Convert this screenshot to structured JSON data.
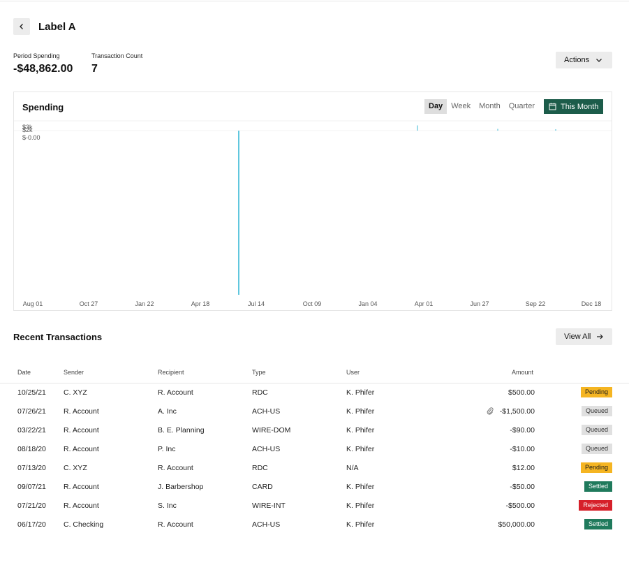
{
  "header": {
    "title": "Label A",
    "back_icon": "chevron-left-icon"
  },
  "stats": {
    "period_spending_label": "Period Spending",
    "period_spending_value": "-$48,862.00",
    "transaction_count_label": "Transaction Count",
    "transaction_count_value": "7"
  },
  "actions": {
    "label": "Actions",
    "icon": "chevron-down-icon"
  },
  "chart": {
    "title": "Spending",
    "periods": [
      "Day",
      "Week",
      "Month",
      "Quarter"
    ],
    "active_period": "Day",
    "range_label": "This Month",
    "range_icon": "calendar-icon",
    "colors": {
      "accent": "#1c5c4a",
      "line": "#39b9d6"
    }
  },
  "chart_data": {
    "type": "line",
    "title": "Spending",
    "xlabel": "",
    "ylabel": "",
    "x_tick_labels": [
      "Aug 01",
      "Oct 27",
      "Jan 22",
      "Apr 18",
      "Jul 14",
      "Oct 09",
      "Jan 04",
      "Apr 01",
      "Jun 27",
      "Sep 22",
      "Dec 18"
    ],
    "y_tick_labels": [
      "$3k",
      "$2k",
      "$-0.00"
    ],
    "x_range": [
      "Aug 01",
      "Dec 18"
    ],
    "grid": false,
    "series": [
      {
        "spikes": [
          {
            "x": "Jun 17",
            "y": 50000
          },
          {
            "x": "Jul 26",
            "y": -1500
          },
          {
            "x": "Mar 22",
            "y": -90
          },
          {
            "x": "Jul 13",
            "y": 12
          },
          {
            "x": "Oct 25",
            "y": 500
          }
        ]
      }
    ]
  },
  "recent": {
    "title": "Recent Transactions",
    "view_all_label": "View All",
    "view_all_icon": "arrow-right-icon"
  },
  "table": {
    "columns": {
      "date": "Date",
      "sender": "Sender",
      "recipient": "Recipient",
      "type": "Type",
      "user": "User",
      "amount": "Amount"
    },
    "rows": [
      {
        "date": "10/25/21",
        "sender": "C. XYZ",
        "recipient": "R. Account",
        "type": "RDC",
        "user": "K. Phifer",
        "amount": "$500.00",
        "attachment": false,
        "status": "Pending",
        "status_color": "#f5b522"
      },
      {
        "date": "07/26/21",
        "sender": "R. Account",
        "recipient": "A. Inc",
        "type": "ACH-US",
        "user": "K. Phifer",
        "amount": "-$1,500.00",
        "attachment": true,
        "status": "Queued",
        "status_color": "#e0e0e0"
      },
      {
        "date": "03/22/21",
        "sender": "R. Account",
        "recipient": "B. E. Planning",
        "type": "WIRE-DOM",
        "user": "K. Phifer",
        "amount": "-$90.00",
        "attachment": false,
        "status": "Queued",
        "status_color": "#e0e0e0"
      },
      {
        "date": "08/18/20",
        "sender": "R. Account",
        "recipient": "P. Inc",
        "type": "ACH-US",
        "user": "K. Phifer",
        "amount": "-$10.00",
        "attachment": false,
        "status": "Queued",
        "status_color": "#e0e0e0"
      },
      {
        "date": "07/13/20",
        "sender": "C. XYZ",
        "recipient": "R. Account",
        "type": "RDC",
        "user": "N/A",
        "amount": "$12.00",
        "attachment": false,
        "status": "Pending",
        "status_color": "#f5b522"
      },
      {
        "date": "09/07/21",
        "sender": "R. Account",
        "recipient": "J. Barbershop",
        "type": "CARD",
        "user": "K. Phifer",
        "amount": "-$50.00",
        "attachment": false,
        "status": "Settled",
        "status_color": "#1f7a5c"
      },
      {
        "date": "07/21/20",
        "sender": "R. Account",
        "recipient": "S. Inc",
        "type": "WIRE-INT",
        "user": "K. Phifer",
        "amount": "-$500.00",
        "attachment": false,
        "status": "Rejected",
        "status_color": "#d6202a"
      },
      {
        "date": "06/17/20",
        "sender": "C. Checking",
        "recipient": "R. Account",
        "type": "ACH-US",
        "user": "K. Phifer",
        "amount": "$50,000.00",
        "attachment": false,
        "status": "Settled",
        "status_color": "#1f7a5c"
      }
    ]
  }
}
